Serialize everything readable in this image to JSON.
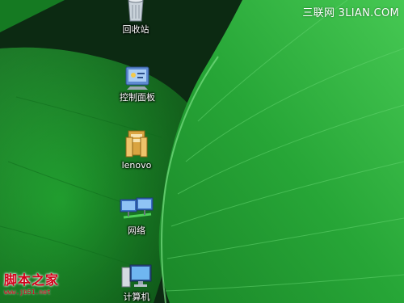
{
  "desktop": {
    "icons": [
      {
        "id": "recycle-bin",
        "label": "回收站",
        "icon": "recycle-bin-icon"
      },
      {
        "id": "control-panel",
        "label": "控制面板",
        "icon": "control-panel-icon"
      },
      {
        "id": "lenovo",
        "label": "lenovo",
        "icon": "folder-icon"
      },
      {
        "id": "network",
        "label": "网络",
        "icon": "network-icon"
      },
      {
        "id": "computer",
        "label": "计算机",
        "icon": "computer-icon"
      }
    ]
  },
  "watermarks": {
    "top": "三联网 3LIAN.COM",
    "bottom_title": "脚本之家",
    "bottom_url": "www.jb51.net"
  },
  "colors": {
    "leaf_green": "#1e9a2e",
    "leaf_light": "#3dbf4a",
    "background_dark": "#0b2a12",
    "watermark_red": "#d4001b"
  }
}
